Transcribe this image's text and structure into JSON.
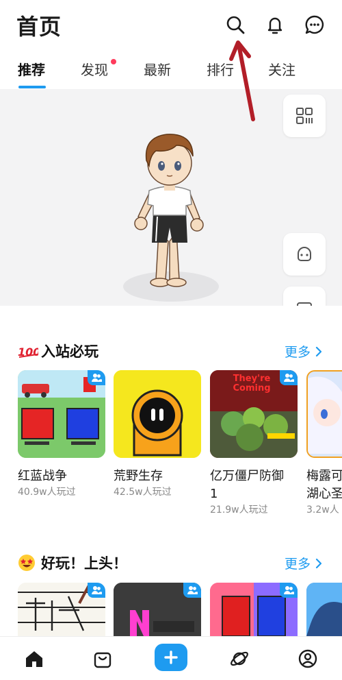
{
  "header": {
    "title": "首页"
  },
  "tabs": [
    {
      "label": "推荐",
      "active": true
    },
    {
      "label": "发现",
      "has_dot": true
    },
    {
      "label": "最新"
    },
    {
      "label": "排行"
    },
    {
      "label": "关注"
    }
  ],
  "sections": [
    {
      "title": "入站必玩",
      "emoji": "hundred-points-icon",
      "more": "更多",
      "games": [
        {
          "name": "红蓝战争",
          "plays": "40.9w人玩过"
        },
        {
          "name": "荒野生存",
          "plays": "42.5w人玩过"
        },
        {
          "name": "亿万僵尸防御",
          "name_line2": "1",
          "plays": "21.9w人玩过"
        },
        {
          "name": "梅露可",
          "name_line2": "湖心圣",
          "plays": "3.2w人"
        }
      ]
    },
    {
      "title": "好玩！上头！",
      "emoji": "star-struck-face-icon",
      "more": "更多"
    }
  ],
  "thumb_texts": {
    "zombie_banner": "They're Coming"
  },
  "colors": {
    "accent": "#1e9bf0",
    "notification_dot": "#ff3b5c",
    "annotation_arrow": "#b21e28"
  }
}
